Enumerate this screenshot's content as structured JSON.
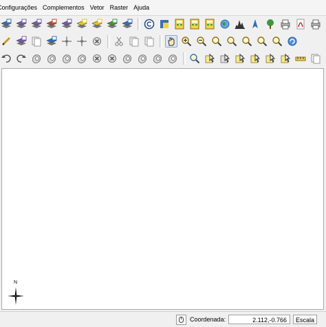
{
  "menu": [
    "Configurações",
    "Complementos",
    "Vetor",
    "Raster",
    "Ajuda"
  ],
  "toolbars": [
    [
      "open-raster-icon",
      "new-layer-icon",
      "add-layer-icon",
      "add-csv-layer-icon",
      "add-spatialite-icon",
      "add-wms-icon",
      "add-wfs-icon",
      "add-vector-icon",
      "add-postgis-icon",
      "separator",
      "copyright-icon",
      "python-console-icon",
      "calculator-icon",
      "field-calculator-icon",
      "raster-calculator-icon",
      "globe-icon",
      "histogram-icon",
      "gps-icon",
      "tree-icon",
      "print-composer-icon",
      "pdf-icon",
      "export-icon"
    ],
    [
      "pencil-icon",
      "toggle-editing-icon",
      "save-edits-icon",
      "add-feature-icon",
      "move-feature-icon",
      "node-tool-icon",
      "delete-icon",
      "separator",
      "cut-icon",
      "copy-icon",
      "paste-icon",
      "separator",
      "pan-icon",
      "zoom-in-icon",
      "zoom-out-icon",
      "zoom-full-icon",
      "zoom-layer-icon",
      "zoom-selection-icon",
      "zoom-last-icon",
      "zoom-next-icon",
      "refresh-icon"
    ],
    [
      "undo-icon",
      "redo-icon",
      "simplify-icon",
      "add-ring-icon",
      "add-part-icon",
      "fill-ring-icon",
      "delete-ring-icon",
      "delete-part-icon",
      "reshape-icon",
      "offset-curve-icon",
      "split-features-icon",
      "split-parts-icon",
      "separator",
      "identify-icon",
      "select-icon",
      "deselect-icon",
      "select-location-icon",
      "select-polygon-icon",
      "select-radius-icon",
      "select-freehand-icon",
      "measure-icon",
      "attribute-table-icon"
    ]
  ],
  "status": {
    "coordinate_label": "Coordenada:",
    "coordinate_value": "2.112,-0.766",
    "scale_label": "Escala"
  },
  "north_arrow_label": "N",
  "colors": {
    "accent_green": "#3a9a3a",
    "accent_blue": "#2f6fb5",
    "accent_yellow": "#e8c21a",
    "canvas_bg": "#ffffff"
  }
}
